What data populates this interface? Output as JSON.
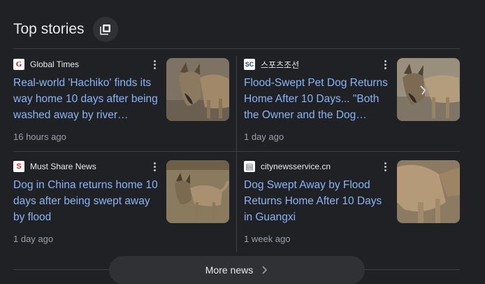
{
  "header": {
    "title": "Top stories",
    "icon": "collections-icon"
  },
  "stories": [
    {
      "source": "Global Times",
      "favicon": {
        "glyph": "G",
        "bg": "#ffffff",
        "fg": "#c4161c"
      },
      "headline": "Real-world 'Hachiko' finds its way home 10 days after being washed away by river…",
      "time": "16 hours ago"
    },
    {
      "source": "스포츠조선",
      "favicon": {
        "glyph": "SC",
        "bg": "#ffffff",
        "fg": "#1a3e8c"
      },
      "headline": "Flood-Swept Pet Dog Returns Home After 10 Days... \"Both the Owner and the Dog…",
      "time": "1 day ago"
    },
    {
      "source": "Must Share News",
      "favicon": {
        "glyph": "S",
        "bg": "#ffffff",
        "fg": "#d93025"
      },
      "headline": "Dog in China returns home 10 days after being swept away by flood",
      "time": "1 day ago"
    },
    {
      "source": "citynewsservice.cn",
      "favicon": {
        "glyph": "▤",
        "bg": "#ffffff",
        "fg": "#5f6368"
      },
      "headline": "Dog Swept Away by Flood Returns Home After 10 Days in Guangxi",
      "time": "1 week ago"
    }
  ],
  "footer": {
    "more_label": "More news"
  },
  "colors": {
    "background": "#202124",
    "link": "#8ab4f8",
    "muted": "#9aa0a6",
    "divider": "#3c4043"
  }
}
